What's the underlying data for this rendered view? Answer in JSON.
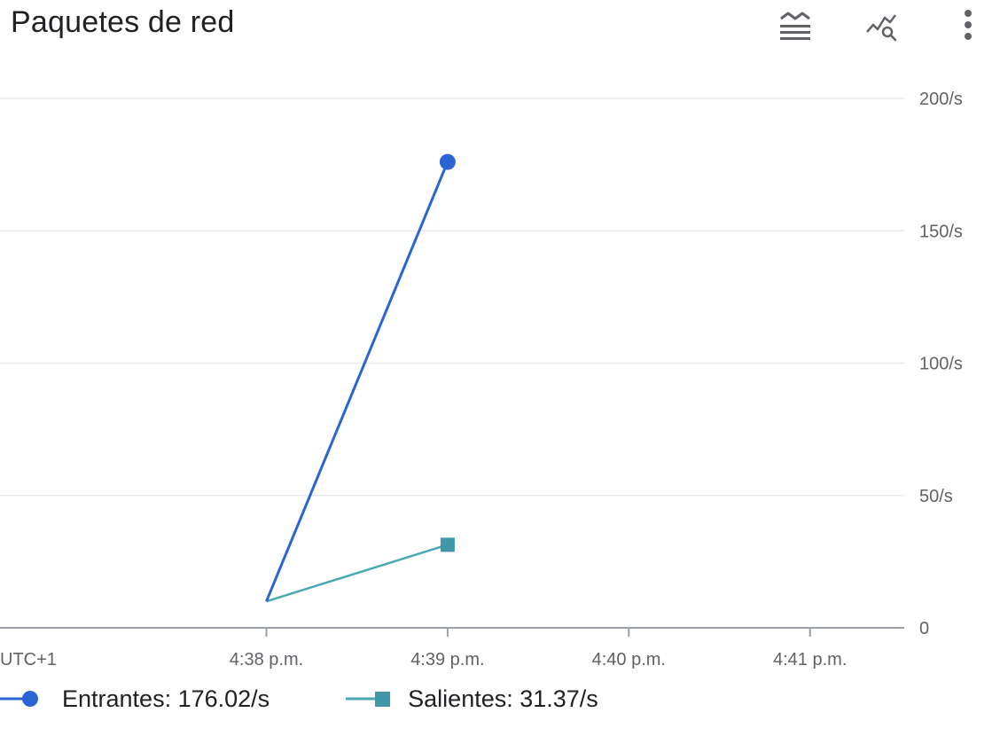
{
  "header": {
    "title": "Paquetes de red",
    "icons": [
      "legend-toggle-icon",
      "explore-icon",
      "more-vert-icon"
    ]
  },
  "legend": {
    "items": [
      {
        "label": "Entrantes: 176.02/s",
        "color": "#2b64d3",
        "marker": "circle"
      },
      {
        "label": "Salientes: 31.37/s",
        "color": "#4aa8b5",
        "marker": "square"
      }
    ]
  },
  "colors": {
    "grid": "#e8eaed",
    "axis": "#9aa0a6",
    "tick_text": "#5f6368",
    "series_in": "#2b64d3",
    "series_out": "#4aa8b5",
    "series_out_marker": "#3f97a8"
  },
  "chart_data": {
    "type": "line",
    "title": "Paquetes de red",
    "xlabel": "",
    "ylabel": "",
    "timezone_label": "UTC+1",
    "x_ticks": [
      "4:38 p.m.",
      "4:39 p.m.",
      "4:40 p.m.",
      "4:41 p.m."
    ],
    "x_range_minutes": [
      36.53,
      41.52
    ],
    "y_ticks": [
      "0",
      "50/s",
      "100/s",
      "150/s",
      "200/s"
    ],
    "ylim": [
      0,
      200
    ],
    "y_tick_values": [
      0,
      50,
      100,
      150,
      200
    ],
    "grid": true,
    "legend_position": "bottom",
    "series": [
      {
        "name": "Entrantes",
        "x_minutes": [
          38.0,
          39.0
        ],
        "x": [
          "4:38 p.m.",
          "4:39 p.m."
        ],
        "values": [
          10,
          176.02
        ]
      },
      {
        "name": "Salientes",
        "x_minutes": [
          38.0,
          39.0
        ],
        "x": [
          "4:38 p.m.",
          "4:39 p.m."
        ],
        "values": [
          10,
          31.37
        ]
      }
    ]
  }
}
